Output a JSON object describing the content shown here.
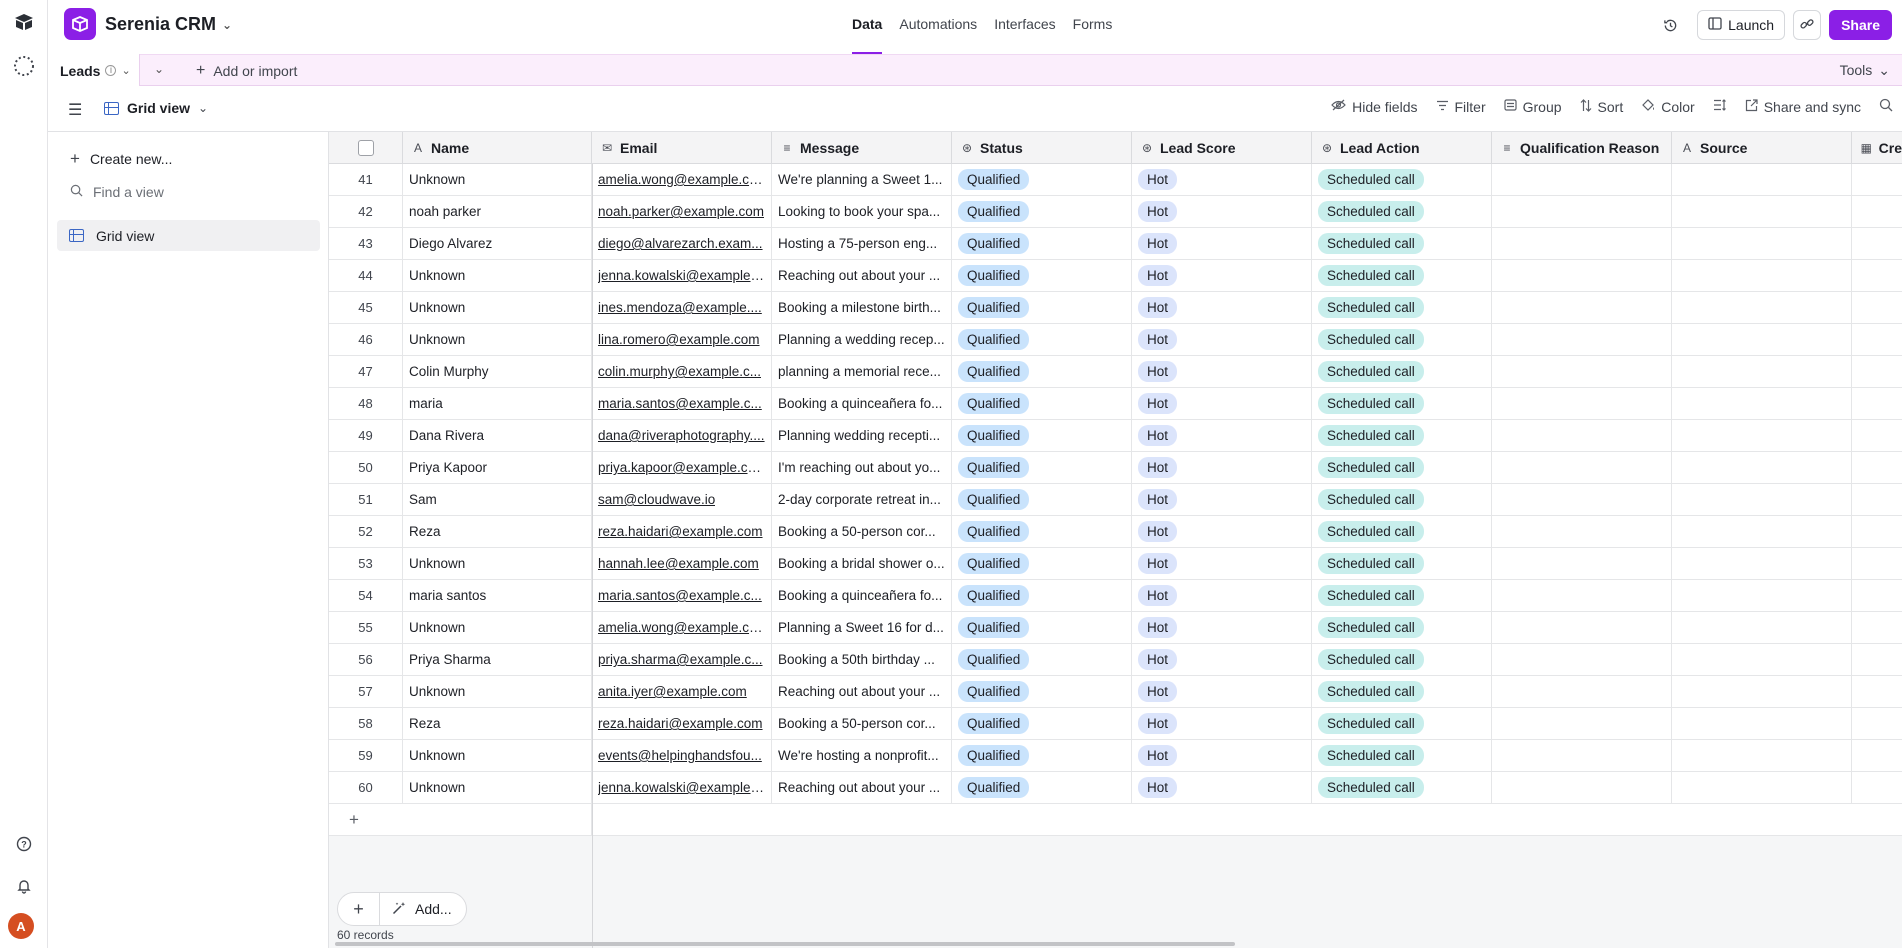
{
  "app": {
    "base_name": "Serenia CRM",
    "nav_tabs": [
      "Data",
      "Automations",
      "Interfaces",
      "Forms"
    ],
    "active_tab": "Data",
    "launch_label": "Launch",
    "share_label": "Share",
    "brand_color": "#8b1fe6",
    "user_initial": "A"
  },
  "tablebar": {
    "table_name": "Leads",
    "add_label": "Add or import",
    "tools_label": "Tools"
  },
  "viewbar": {
    "view_name": "Grid view",
    "tools": [
      "Hide fields",
      "Filter",
      "Group",
      "Sort",
      "Color",
      "Share and sync"
    ]
  },
  "sidebar": {
    "create_label": "Create new...",
    "find_placeholder": "Find a view",
    "views": [
      "Grid view"
    ]
  },
  "grid": {
    "columns": [
      {
        "label": "Name",
        "icon": "text-field-icon"
      },
      {
        "label": "Email",
        "icon": "email-field-icon"
      },
      {
        "label": "Message",
        "icon": "long-text-field-icon"
      },
      {
        "label": "Status",
        "icon": "single-select-field-icon"
      },
      {
        "label": "Lead Score",
        "icon": "single-select-field-icon"
      },
      {
        "label": "Lead Action",
        "icon": "single-select-field-icon"
      },
      {
        "label": "Qualification Reason",
        "icon": "long-text-field-icon"
      },
      {
        "label": "Source",
        "icon": "text-field-icon"
      },
      {
        "label": "Cre",
        "icon": "date-field-icon"
      }
    ],
    "rows": [
      {
        "id": "41",
        "name": "Unknown",
        "email": "amelia.wong@example.com",
        "message": "We're planning a Sweet 1...",
        "status": "Qualified",
        "score": "Hot",
        "action": "Scheduled call"
      },
      {
        "id": "42",
        "name": "noah parker",
        "email": "noah.parker@example.com",
        "message": "Looking to book your spa...",
        "status": "Qualified",
        "score": "Hot",
        "action": "Scheduled call"
      },
      {
        "id": "43",
        "name": "Diego Alvarez",
        "email": "diego@alvarezarch.exam...",
        "message": "Hosting a 75-person eng...",
        "status": "Qualified",
        "score": "Hot",
        "action": "Scheduled call"
      },
      {
        "id": "44",
        "name": "Unknown",
        "email": "jenna.kowalski@example....",
        "message": "Reaching out about your ...",
        "status": "Qualified",
        "score": "Hot",
        "action": "Scheduled call"
      },
      {
        "id": "45",
        "name": "Unknown",
        "email": "ines.mendoza@example....",
        "message": "Booking a milestone birth...",
        "status": "Qualified",
        "score": "Hot",
        "action": "Scheduled call"
      },
      {
        "id": "46",
        "name": "Unknown",
        "email": "lina.romero@example.com",
        "message": "Planning a wedding recep...",
        "status": "Qualified",
        "score": "Hot",
        "action": "Scheduled call"
      },
      {
        "id": "47",
        "name": "Colin Murphy",
        "email": "colin.murphy@example.c...",
        "message": "planning a memorial rece...",
        "status": "Qualified",
        "score": "Hot",
        "action": "Scheduled call"
      },
      {
        "id": "48",
        "name": "maria",
        "email": "maria.santos@example.c...",
        "message": "Booking a quinceañera fo...",
        "status": "Qualified",
        "score": "Hot",
        "action": "Scheduled call"
      },
      {
        "id": "49",
        "name": "Dana Rivera",
        "email": "dana@riveraphotography....",
        "message": "Planning wedding recepti...",
        "status": "Qualified",
        "score": "Hot",
        "action": "Scheduled call"
      },
      {
        "id": "50",
        "name": "Priya Kapoor",
        "email": "priya.kapoor@example.co...",
        "message": "I'm reaching out about yo...",
        "status": "Qualified",
        "score": "Hot",
        "action": "Scheduled call"
      },
      {
        "id": "51",
        "name": "Sam",
        "email": "sam@cloudwave.io",
        "message": "2-day corporate retreat in...",
        "status": "Qualified",
        "score": "Hot",
        "action": "Scheduled call"
      },
      {
        "id": "52",
        "name": "Reza",
        "email": "reza.haidari@example.com",
        "message": "Booking a 50-person cor...",
        "status": "Qualified",
        "score": "Hot",
        "action": "Scheduled call"
      },
      {
        "id": "53",
        "name": "Unknown",
        "email": "hannah.lee@example.com",
        "message": "Booking a bridal shower o...",
        "status": "Qualified",
        "score": "Hot",
        "action": "Scheduled call"
      },
      {
        "id": "54",
        "name": "maria santos",
        "email": "maria.santos@example.c...",
        "message": "Booking a quinceañera fo...",
        "status": "Qualified",
        "score": "Hot",
        "action": "Scheduled call"
      },
      {
        "id": "55",
        "name": "Unknown",
        "email": "amelia.wong@example.com",
        "message": "Planning a Sweet 16 for d...",
        "status": "Qualified",
        "score": "Hot",
        "action": "Scheduled call"
      },
      {
        "id": "56",
        "name": "Priya Sharma",
        "email": "priya.sharma@example.c...",
        "message": "Booking a 50th birthday ...",
        "status": "Qualified",
        "score": "Hot",
        "action": "Scheduled call"
      },
      {
        "id": "57",
        "name": "Unknown",
        "email": "anita.iyer@example.com",
        "message": "Reaching out about your ...",
        "status": "Qualified",
        "score": "Hot",
        "action": "Scheduled call"
      },
      {
        "id": "58",
        "name": "Reza",
        "email": "reza.haidari@example.com",
        "message": "Booking a 50-person cor...",
        "status": "Qualified",
        "score": "Hot",
        "action": "Scheduled call"
      },
      {
        "id": "59",
        "name": "Unknown",
        "email": "events@helpinghandsfou...",
        "message": "We're hosting a nonprofit...",
        "status": "Qualified",
        "score": "Hot",
        "action": "Scheduled call"
      },
      {
        "id": "60",
        "name": "Unknown",
        "email": "jenna.kowalski@example....",
        "message": "Reaching out about your ...",
        "status": "Qualified",
        "score": "Hot",
        "action": "Scheduled call"
      }
    ],
    "add_label": "Add...",
    "record_count": "60 records"
  }
}
